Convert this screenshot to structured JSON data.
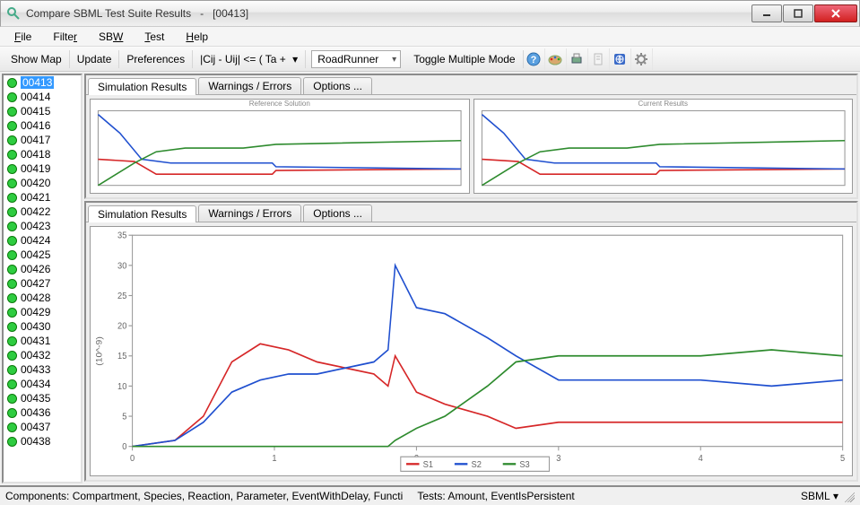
{
  "window": {
    "title": "Compare SBML Test Suite Results",
    "title_sep": "-",
    "title_id": "[00413]"
  },
  "menu": [
    "File",
    "Filter",
    "SBW",
    "Test",
    "Help"
  ],
  "toolbar": {
    "show_map": "Show Map",
    "update": "Update",
    "preferences": "Preferences",
    "formula": "|Cij - Uij| <= ( Ta +",
    "runner": "RoadRunner",
    "toggle": "Toggle Multiple Mode"
  },
  "sidebar": {
    "selected": "00413",
    "items": [
      "00413",
      "00414",
      "00415",
      "00416",
      "00417",
      "00418",
      "00419",
      "00420",
      "00421",
      "00422",
      "00423",
      "00424",
      "00425",
      "00426",
      "00427",
      "00428",
      "00429",
      "00430",
      "00431",
      "00432",
      "00433",
      "00434",
      "00435",
      "00436",
      "00437",
      "00438"
    ]
  },
  "tabs": {
    "sim": "Simulation Results",
    "warn": "Warnings / Errors",
    "opt": "Options ..."
  },
  "mini_titles": {
    "left": "Reference Solution",
    "right": "Current Results"
  },
  "status": {
    "components": "Components: Compartment, Species, Reaction, Parameter, EventWithDelay, Functi",
    "tests": "Tests: Amount, EventIsPersistent",
    "right_label": "SBML"
  },
  "chart_data": {
    "type": "line",
    "xlabel": "",
    "ylabel": "(10^-9)",
    "xlim": [
      0,
      5
    ],
    "ylim": [
      0,
      35
    ],
    "xticks": [
      0,
      1,
      2,
      3,
      4,
      5
    ],
    "yticks": [
      0,
      5,
      10,
      15,
      20,
      25,
      30,
      35
    ],
    "series": [
      {
        "name": "S1",
        "color": "#d62728",
        "x": [
          0,
          0.3,
          0.5,
          0.7,
          0.9,
          1.1,
          1.3,
          1.5,
          1.7,
          1.8,
          1.85,
          2.0,
          2.2,
          2.5,
          2.7,
          3.0,
          3.5,
          4.0,
          4.5,
          5.0
        ],
        "y": [
          0,
          1,
          5,
          14,
          17,
          16,
          14,
          13,
          12,
          10,
          15,
          9,
          7,
          5,
          3,
          4,
          4,
          4,
          4,
          4
        ]
      },
      {
        "name": "S2",
        "color": "#1f4fcf",
        "x": [
          0,
          0.3,
          0.5,
          0.7,
          0.9,
          1.1,
          1.3,
          1.5,
          1.7,
          1.8,
          1.85,
          2.0,
          2.2,
          2.5,
          2.7,
          3.0,
          3.5,
          4.0,
          4.5,
          5.0
        ],
        "y": [
          0,
          1,
          4,
          9,
          11,
          12,
          12,
          13,
          14,
          16,
          30,
          23,
          22,
          18,
          15,
          11,
          11,
          11,
          10,
          11
        ]
      },
      {
        "name": "S3",
        "color": "#2e8b2e",
        "x": [
          0,
          0.3,
          0.5,
          0.7,
          0.9,
          1.1,
          1.3,
          1.5,
          1.7,
          1.8,
          1.85,
          2.0,
          2.2,
          2.5,
          2.7,
          3.0,
          3.5,
          4.0,
          4.5,
          5.0
        ],
        "y": [
          0,
          0,
          0,
          0,
          0,
          0,
          0,
          0,
          0,
          0,
          1,
          3,
          5,
          10,
          14,
          15,
          15,
          15,
          16,
          15
        ]
      }
    ]
  },
  "mini_chart_data": {
    "type": "line",
    "xlim": [
      0,
      5
    ],
    "ylim": [
      0,
      1
    ],
    "series": [
      {
        "name": "S1",
        "color": "#d62728",
        "x": [
          0,
          0.5,
          0.8,
          1.3,
          2.4,
          2.45,
          5.0
        ],
        "y": [
          0.35,
          0.32,
          0.15,
          0.15,
          0.15,
          0.2,
          0.22
        ]
      },
      {
        "name": "S2",
        "color": "#1f4fcf",
        "x": [
          0,
          0.3,
          0.6,
          1.0,
          2.4,
          2.45,
          5.0
        ],
        "y": [
          0.95,
          0.7,
          0.35,
          0.3,
          0.3,
          0.25,
          0.22
        ]
      },
      {
        "name": "S3",
        "color": "#2e8b2e",
        "x": [
          0,
          0.5,
          0.8,
          1.2,
          2.0,
          2.45,
          5.0
        ],
        "y": [
          0.0,
          0.3,
          0.45,
          0.5,
          0.5,
          0.55,
          0.6
        ]
      }
    ]
  },
  "colors": {
    "s1": "#d62728",
    "s2": "#1f4fcf",
    "s3": "#2e8b2e"
  }
}
